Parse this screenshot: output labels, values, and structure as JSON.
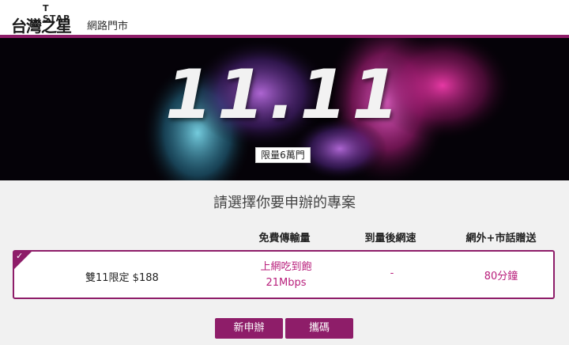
{
  "header": {
    "brand_en": "T STAR",
    "brand_zh": "台灣之星",
    "store_label": "網路門市",
    "accent_color": "#8e1d69"
  },
  "banner": {
    "title": "11.11",
    "badge": "限量6萬門"
  },
  "main": {
    "select_title": "請選擇你要申辦的專案",
    "columns": [
      "免費傳輸量",
      "到量後網速",
      "網外+市話贈送"
    ],
    "plan": {
      "selected": true,
      "name": "雙11限定 $188",
      "data_line1": "上網吃到飽",
      "data_line2": "21Mbps",
      "speed_after": "-",
      "free_minutes": "80分鐘"
    },
    "buttons": {
      "new_label": "新申辦",
      "transfer_label": "攜碼"
    }
  }
}
